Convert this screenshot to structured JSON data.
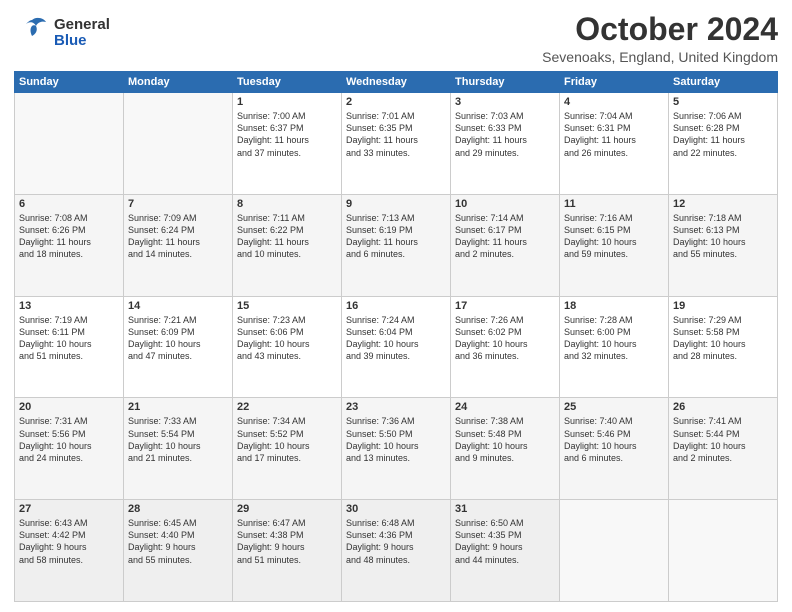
{
  "header": {
    "logo_general": "General",
    "logo_blue": "Blue",
    "month_title": "October 2024",
    "subtitle": "Sevenoaks, England, United Kingdom"
  },
  "days_of_week": [
    "Sunday",
    "Monday",
    "Tuesday",
    "Wednesday",
    "Thursday",
    "Friday",
    "Saturday"
  ],
  "weeks": [
    [
      {
        "day": "",
        "data": ""
      },
      {
        "day": "",
        "data": ""
      },
      {
        "day": "1",
        "data": "Sunrise: 7:00 AM\nSunset: 6:37 PM\nDaylight: 11 hours\nand 37 minutes."
      },
      {
        "day": "2",
        "data": "Sunrise: 7:01 AM\nSunset: 6:35 PM\nDaylight: 11 hours\nand 33 minutes."
      },
      {
        "day": "3",
        "data": "Sunrise: 7:03 AM\nSunset: 6:33 PM\nDaylight: 11 hours\nand 29 minutes."
      },
      {
        "day": "4",
        "data": "Sunrise: 7:04 AM\nSunset: 6:31 PM\nDaylight: 11 hours\nand 26 minutes."
      },
      {
        "day": "5",
        "data": "Sunrise: 7:06 AM\nSunset: 6:28 PM\nDaylight: 11 hours\nand 22 minutes."
      }
    ],
    [
      {
        "day": "6",
        "data": "Sunrise: 7:08 AM\nSunset: 6:26 PM\nDaylight: 11 hours\nand 18 minutes."
      },
      {
        "day": "7",
        "data": "Sunrise: 7:09 AM\nSunset: 6:24 PM\nDaylight: 11 hours\nand 14 minutes."
      },
      {
        "day": "8",
        "data": "Sunrise: 7:11 AM\nSunset: 6:22 PM\nDaylight: 11 hours\nand 10 minutes."
      },
      {
        "day": "9",
        "data": "Sunrise: 7:13 AM\nSunset: 6:19 PM\nDaylight: 11 hours\nand 6 minutes."
      },
      {
        "day": "10",
        "data": "Sunrise: 7:14 AM\nSunset: 6:17 PM\nDaylight: 11 hours\nand 2 minutes."
      },
      {
        "day": "11",
        "data": "Sunrise: 7:16 AM\nSunset: 6:15 PM\nDaylight: 10 hours\nand 59 minutes."
      },
      {
        "day": "12",
        "data": "Sunrise: 7:18 AM\nSunset: 6:13 PM\nDaylight: 10 hours\nand 55 minutes."
      }
    ],
    [
      {
        "day": "13",
        "data": "Sunrise: 7:19 AM\nSunset: 6:11 PM\nDaylight: 10 hours\nand 51 minutes."
      },
      {
        "day": "14",
        "data": "Sunrise: 7:21 AM\nSunset: 6:09 PM\nDaylight: 10 hours\nand 47 minutes."
      },
      {
        "day": "15",
        "data": "Sunrise: 7:23 AM\nSunset: 6:06 PM\nDaylight: 10 hours\nand 43 minutes."
      },
      {
        "day": "16",
        "data": "Sunrise: 7:24 AM\nSunset: 6:04 PM\nDaylight: 10 hours\nand 39 minutes."
      },
      {
        "day": "17",
        "data": "Sunrise: 7:26 AM\nSunset: 6:02 PM\nDaylight: 10 hours\nand 36 minutes."
      },
      {
        "day": "18",
        "data": "Sunrise: 7:28 AM\nSunset: 6:00 PM\nDaylight: 10 hours\nand 32 minutes."
      },
      {
        "day": "19",
        "data": "Sunrise: 7:29 AM\nSunset: 5:58 PM\nDaylight: 10 hours\nand 28 minutes."
      }
    ],
    [
      {
        "day": "20",
        "data": "Sunrise: 7:31 AM\nSunset: 5:56 PM\nDaylight: 10 hours\nand 24 minutes."
      },
      {
        "day": "21",
        "data": "Sunrise: 7:33 AM\nSunset: 5:54 PM\nDaylight: 10 hours\nand 21 minutes."
      },
      {
        "day": "22",
        "data": "Sunrise: 7:34 AM\nSunset: 5:52 PM\nDaylight: 10 hours\nand 17 minutes."
      },
      {
        "day": "23",
        "data": "Sunrise: 7:36 AM\nSunset: 5:50 PM\nDaylight: 10 hours\nand 13 minutes."
      },
      {
        "day": "24",
        "data": "Sunrise: 7:38 AM\nSunset: 5:48 PM\nDaylight: 10 hours\nand 9 minutes."
      },
      {
        "day": "25",
        "data": "Sunrise: 7:40 AM\nSunset: 5:46 PM\nDaylight: 10 hours\nand 6 minutes."
      },
      {
        "day": "26",
        "data": "Sunrise: 7:41 AM\nSunset: 5:44 PM\nDaylight: 10 hours\nand 2 minutes."
      }
    ],
    [
      {
        "day": "27",
        "data": "Sunrise: 6:43 AM\nSunset: 4:42 PM\nDaylight: 9 hours\nand 58 minutes."
      },
      {
        "day": "28",
        "data": "Sunrise: 6:45 AM\nSunset: 4:40 PM\nDaylight: 9 hours\nand 55 minutes."
      },
      {
        "day": "29",
        "data": "Sunrise: 6:47 AM\nSunset: 4:38 PM\nDaylight: 9 hours\nand 51 minutes."
      },
      {
        "day": "30",
        "data": "Sunrise: 6:48 AM\nSunset: 4:36 PM\nDaylight: 9 hours\nand 48 minutes."
      },
      {
        "day": "31",
        "data": "Sunrise: 6:50 AM\nSunset: 4:35 PM\nDaylight: 9 hours\nand 44 minutes."
      },
      {
        "day": "",
        "data": ""
      },
      {
        "day": "",
        "data": ""
      }
    ]
  ]
}
